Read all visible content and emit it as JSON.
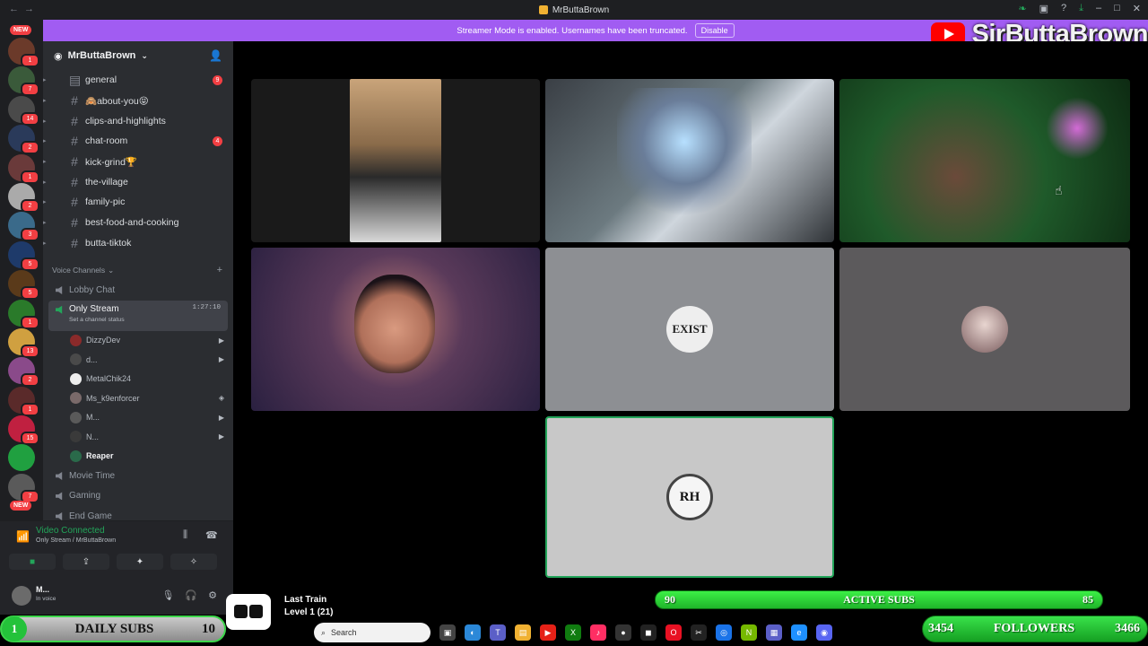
{
  "titlebar": {
    "title": "MrButtaBrown"
  },
  "banner": {
    "message": "Streamer Mode is enabled. Usernames have been truncated.",
    "disable_label": "Disable"
  },
  "overlay_brand": {
    "name": "SirButtaBrown"
  },
  "guild_bar": {
    "top_tag": "NEW",
    "bottom_tag": "NEW",
    "badges": [
      "1",
      "7",
      "14",
      "2",
      "1",
      "2",
      "3",
      "5",
      "5",
      "1",
      "13",
      "2",
      "1",
      "15",
      "",
      "7"
    ]
  },
  "server": {
    "name": "MrButtaBrown"
  },
  "text_channels": [
    {
      "name": "general",
      "unread": "9"
    },
    {
      "name": "🙈about-you😝",
      "unread": ""
    },
    {
      "name": "clips-and-highlights",
      "unread": ""
    },
    {
      "name": "chat-room",
      "unread": "4"
    },
    {
      "name": "kick-grind🏆",
      "unread": ""
    },
    {
      "name": "the-village",
      "unread": ""
    },
    {
      "name": "family-pic",
      "unread": ""
    },
    {
      "name": "best-food-and-cooking",
      "unread": ""
    },
    {
      "name": "butta-tiktok",
      "unread": ""
    }
  ],
  "voice_category": "Voice Channels",
  "voice_channels_top": [
    {
      "name": "Lobby Chat"
    }
  ],
  "active_voice": {
    "name": "Only Stream",
    "timer": "1:27:10",
    "status": "Set a channel status"
  },
  "voice_users": [
    {
      "name": "DizzyDev",
      "icon": "▶"
    },
    {
      "name": "d...",
      "icon": "▶"
    },
    {
      "name": "MetalChik24",
      "icon": ""
    },
    {
      "name": "Ms_k9enforcer",
      "icon": "◈"
    },
    {
      "name": "M...",
      "icon": "▶"
    },
    {
      "name": "N...",
      "icon": "▶"
    },
    {
      "name": "Reaper",
      "icon": ""
    }
  ],
  "voice_channels_bottom": [
    {
      "name": "Movie Time"
    },
    {
      "name": "Gaming"
    },
    {
      "name": "End Game"
    }
  ],
  "voice_panel": {
    "status": "Video Connected",
    "location": "Only Stream / MrButtaBrown"
  },
  "user_panel": {
    "name": "M...",
    "status": "In voice"
  },
  "tiles": [
    {
      "label": "EXIST"
    },
    {
      "label": "RH"
    }
  ],
  "active_subs": {
    "left": "90",
    "label": "ACTIVE SUBS",
    "right": "85"
  },
  "daily_subs": {
    "left": "1",
    "label": "DAILY SUBS",
    "right": "10"
  },
  "followers": {
    "left": "3454",
    "label": "FOLLOWERS",
    "right": "3466"
  },
  "music": {
    "track": "Last Train",
    "level": "Level 1 (21)"
  },
  "taskbar": {
    "search_placeholder": "Search"
  },
  "colors": {
    "accent": "#a15cf2",
    "green": "#23a55a",
    "overlay_green": "#3cf046"
  }
}
